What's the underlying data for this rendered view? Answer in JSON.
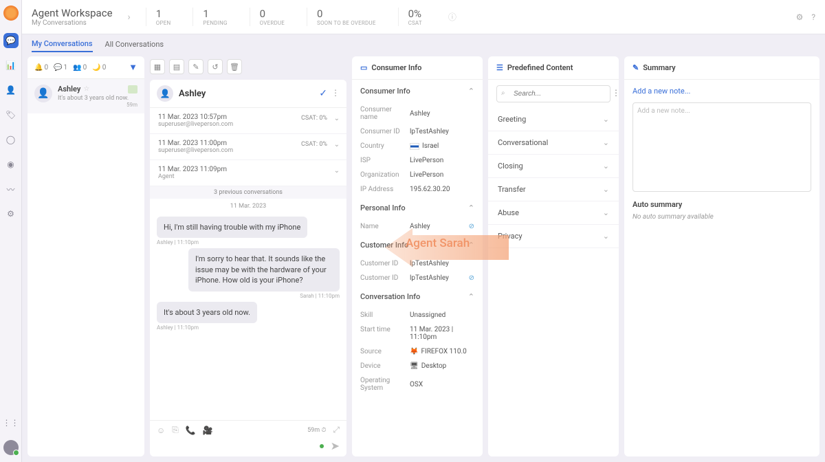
{
  "header": {
    "title": "Agent Workspace",
    "subtitle": "My Conversations",
    "stats": [
      {
        "value": "1",
        "label": "OPEN"
      },
      {
        "value": "1",
        "label": "PENDING"
      },
      {
        "value": "0",
        "label": "OVERDUE"
      },
      {
        "value": "0",
        "label": "SOON TO BE OVERDUE"
      },
      {
        "value": "0%",
        "label": "CSAT"
      }
    ]
  },
  "tabs": {
    "my": "My Conversations",
    "all": "All Conversations"
  },
  "convlist": {
    "counts": {
      "overdue": "0",
      "open": "1",
      "pending": "0",
      "idle": "0"
    },
    "item": {
      "name": "Ashley",
      "preview": "It's about 3 years old now.",
      "time": "59m"
    }
  },
  "chat": {
    "name": "Ashley",
    "history": [
      {
        "dt": "11 Mar. 2023 10:57pm",
        "em": "superuser@liveperson.com",
        "csat": "CSAT: 0%"
      },
      {
        "dt": "11 Mar. 2023 11:00pm",
        "em": "superuser@liveperson.com",
        "csat": "CSAT: 0%"
      },
      {
        "dt": "11 Mar. 2023 11:09pm",
        "em": "Agent",
        "csat": ""
      }
    ],
    "prev_label": "3 previous conversations",
    "date_divider": "11 Mar. 2023",
    "messages": [
      {
        "who": "cust",
        "text": "Hi, I'm still having trouble with my iPhone",
        "meta": "Ashley  |  11:10pm"
      },
      {
        "who": "agent",
        "text": "I'm sorry to hear that. It sounds like the issue may be with the hardware of your iPhone. How old is your iPhone?",
        "meta": "Sarah  |  11:10pm"
      },
      {
        "who": "cust",
        "text": "It's about 3 years old now.",
        "meta": "Ashley  |  11:10pm"
      }
    ],
    "timer": "59m"
  },
  "consumer": {
    "panel_title": "Consumer Info",
    "sections": {
      "consumer_info": "Consumer Info",
      "personal_info": "Personal Info",
      "customer_info": "Customer Info",
      "conversation_info": "Conversation Info"
    },
    "fields": {
      "name_k": "Consumer name",
      "name_v": "Ashley",
      "id_k": "Consumer ID",
      "id_v": "lpTestAshley",
      "country_k": "Country",
      "country_v": "Israel",
      "isp_k": "ISP",
      "isp_v": "LivePerson",
      "org_k": "Organization",
      "org_v": "LivePerson",
      "ip_k": "IP Address",
      "ip_v": "195.62.30.20",
      "pname_k": "Name",
      "pname_v": "Ashley",
      "cid1_k": "Customer ID",
      "cid1_v": "lpTestAshley",
      "cid2_k": "Customer ID",
      "cid2_v": "lpTestAshley",
      "skill_k": "Skill",
      "skill_v": "Unassigned",
      "start_k": "Start time",
      "start_v": "11 Mar. 2023 | 11:10pm",
      "source_k": "Source",
      "source_v": "FIREFOX 110.0",
      "device_k": "Device",
      "device_v": "Desktop",
      "os_k": "Operating System",
      "os_v": "OSX"
    }
  },
  "predefined": {
    "title": "Predefined Content",
    "search_placeholder": "Search...",
    "cats": [
      "Greeting",
      "Conversational",
      "Closing",
      "Transfer",
      "Abuse",
      "Privacy"
    ]
  },
  "summary": {
    "title": "Summary",
    "add_link": "Add a new note...",
    "placeholder": "Add a new note...",
    "auto_head": "Auto summary",
    "auto_text": "No auto summary available"
  },
  "annotation": "Agent Sarah"
}
